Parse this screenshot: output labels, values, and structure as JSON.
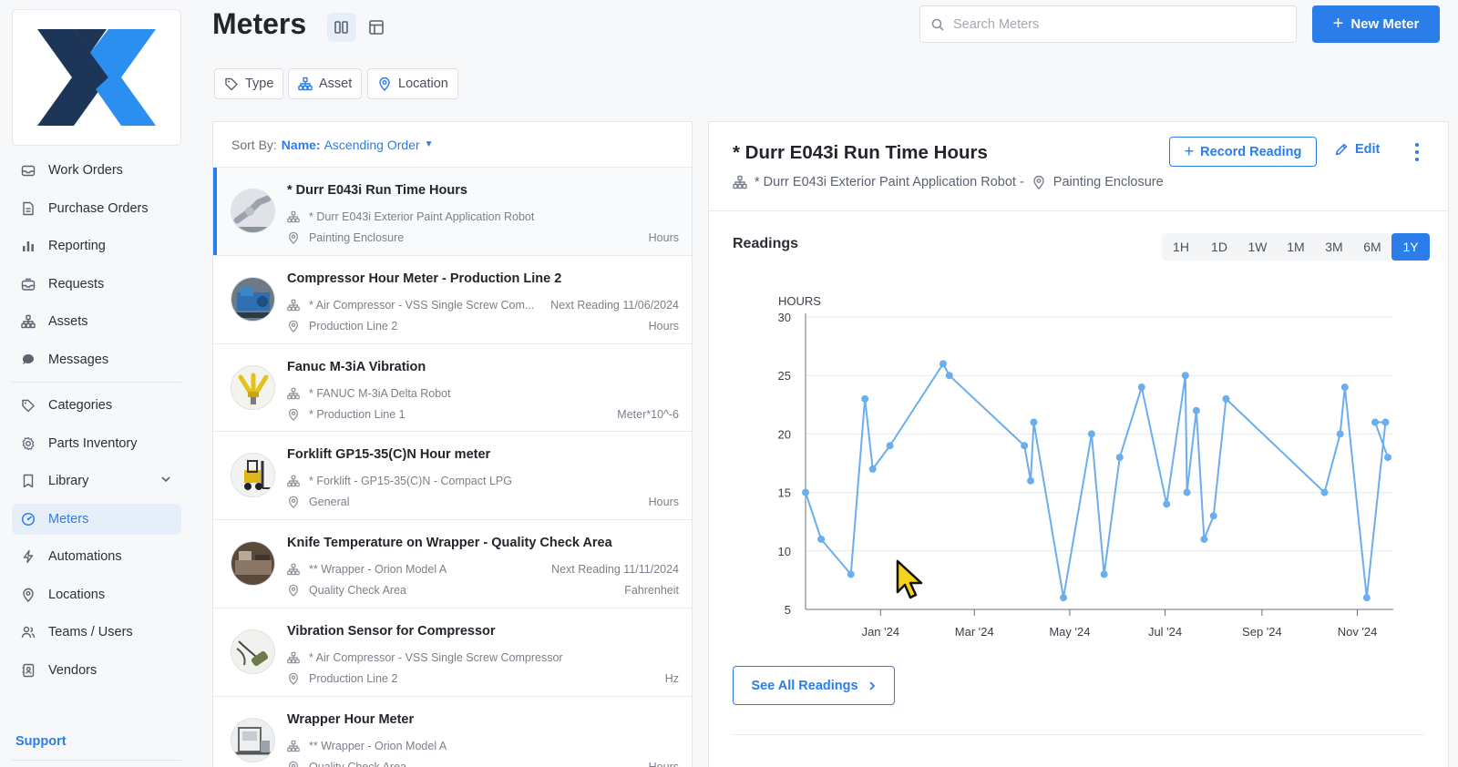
{
  "app": {
    "title": "Meters"
  },
  "sidebar": {
    "items": [
      {
        "label": "Work Orders",
        "icon": "work-orders-icon"
      },
      {
        "label": "Purchase Orders",
        "icon": "purchase-orders-icon"
      },
      {
        "label": "Reporting",
        "icon": "reporting-icon"
      },
      {
        "label": "Requests",
        "icon": "requests-icon"
      },
      {
        "label": "Assets",
        "icon": "assets-icon"
      },
      {
        "label": "Messages",
        "icon": "messages-icon"
      },
      {
        "label": "Categories",
        "icon": "tag-icon"
      },
      {
        "label": "Parts Inventory",
        "icon": "gear-icon"
      },
      {
        "label": "Library",
        "icon": "bookmark-icon"
      },
      {
        "label": "Meters",
        "icon": "gauge-icon",
        "active": true
      },
      {
        "label": "Automations",
        "icon": "lightning-icon"
      },
      {
        "label": "Locations",
        "icon": "location-pin-icon"
      },
      {
        "label": "Teams / Users",
        "icon": "users-icon"
      },
      {
        "label": "Vendors",
        "icon": "vendor-icon"
      }
    ],
    "support_label": "Support"
  },
  "header": {
    "search_placeholder": "Search Meters",
    "new_button": "New Meter",
    "filters": [
      "Type",
      "Asset",
      "Location"
    ]
  },
  "list": {
    "sort_prefix": "Sort By:",
    "sort_field": "Name:",
    "sort_value": "Ascending Order",
    "items": [
      {
        "title": "* Durr E043i Run Time Hours",
        "asset": "* Durr E043i Exterior Paint Application Robot",
        "location": "Painting Enclosure",
        "next_reading": "",
        "unit": "Hours",
        "thumb": "robot-arm"
      },
      {
        "title": "Compressor Hour Meter - Production Line 2",
        "asset": "* Air Compressor - VSS Single Screw Com...",
        "location": "Production Line 2",
        "next_reading": "Next Reading 11/06/2024",
        "unit": "Hours",
        "thumb": "compressor"
      },
      {
        "title": "Fanuc M-3iA Vibration",
        "asset": "* FANUC M-3iA Delta Robot",
        "location": "* Production Line 1",
        "next_reading": "",
        "unit": "Meter*10^-6",
        "thumb": "delta-robot"
      },
      {
        "title": "Forklift GP15-35(C)N Hour meter",
        "asset": "* Forklift - GP15-35(C)N - Compact LPG",
        "location": "General",
        "next_reading": "",
        "unit": "Hours",
        "thumb": "forklift"
      },
      {
        "title": "Knife Temperature on Wrapper - Quality Check Area",
        "asset": "** Wrapper - Orion Model A",
        "location": "Quality Check Area",
        "next_reading": "Next Reading 11/11/2024",
        "unit": "Fahrenheit",
        "thumb": "wrapper"
      },
      {
        "title": "Vibration Sensor for Compressor",
        "asset": "* Air Compressor - VSS Single Screw Compressor",
        "location": "Production Line 2",
        "next_reading": "",
        "unit": "Hz",
        "thumb": "sensor"
      },
      {
        "title": "Wrapper Hour Meter",
        "asset": "** Wrapper - Orion Model A",
        "location": "Quality Check Area",
        "next_reading": "",
        "unit": "Hours",
        "thumb": "wrapper-machine"
      }
    ]
  },
  "detail": {
    "title": "* Durr E043i Run Time Hours",
    "asset": "* Durr E043i Exterior Paint Application Robot -",
    "location": "Painting Enclosure",
    "record_button": "Record Reading",
    "edit_button": "Edit",
    "readings_label": "Readings",
    "ranges": [
      "1H",
      "1D",
      "1W",
      "1M",
      "3M",
      "6M",
      "1Y"
    ],
    "selected_range": "1Y",
    "see_all_button": "See All Readings"
  },
  "colors": {
    "accent": "#2b7de9",
    "line": "#6aaef0"
  },
  "chart_data": {
    "type": "line",
    "ylabel": "HOURS",
    "ylim": [
      5,
      30
    ],
    "yticks": [
      5,
      10,
      15,
      20,
      25,
      30
    ],
    "xlim": [
      "2023-11-14",
      "2024-11-24"
    ],
    "xticks": [
      {
        "x": "2024-01-01",
        "label": "Jan '24"
      },
      {
        "x": "2024-03-01",
        "label": "Mar '24"
      },
      {
        "x": "2024-05-01",
        "label": "May '24"
      },
      {
        "x": "2024-07-01",
        "label": "Jul '24"
      },
      {
        "x": "2024-09-01",
        "label": "Sep '24"
      },
      {
        "x": "2024-11-01",
        "label": "Nov '24"
      }
    ],
    "grid": true,
    "series": [
      {
        "x": [
          "2023-11-14",
          "2023-11-24",
          "2023-12-13",
          "2023-12-22",
          "2023-12-27",
          "2024-01-07",
          "2024-02-10",
          "2024-02-14",
          "2024-04-02",
          "2024-04-06",
          "2024-04-08",
          "2024-04-27",
          "2024-05-15",
          "2024-05-23",
          "2024-06-02",
          "2024-06-16",
          "2024-07-02",
          "2024-07-14",
          "2024-07-15",
          "2024-07-21",
          "2024-07-26",
          "2024-08-01",
          "2024-08-09",
          "2024-10-11",
          "2024-10-21",
          "2024-10-24",
          "2024-11-07",
          "2024-11-19",
          "2024-11-24"
        ],
        "y": [
          15,
          11,
          8,
          23,
          17,
          19,
          26,
          25,
          19,
          16,
          21,
          6,
          20,
          8,
          18,
          24,
          14,
          25,
          15,
          22,
          11,
          13,
          23,
          15,
          20,
          24,
          6,
          21,
          21
        ],
        "last_y": 18
      }
    ]
  }
}
